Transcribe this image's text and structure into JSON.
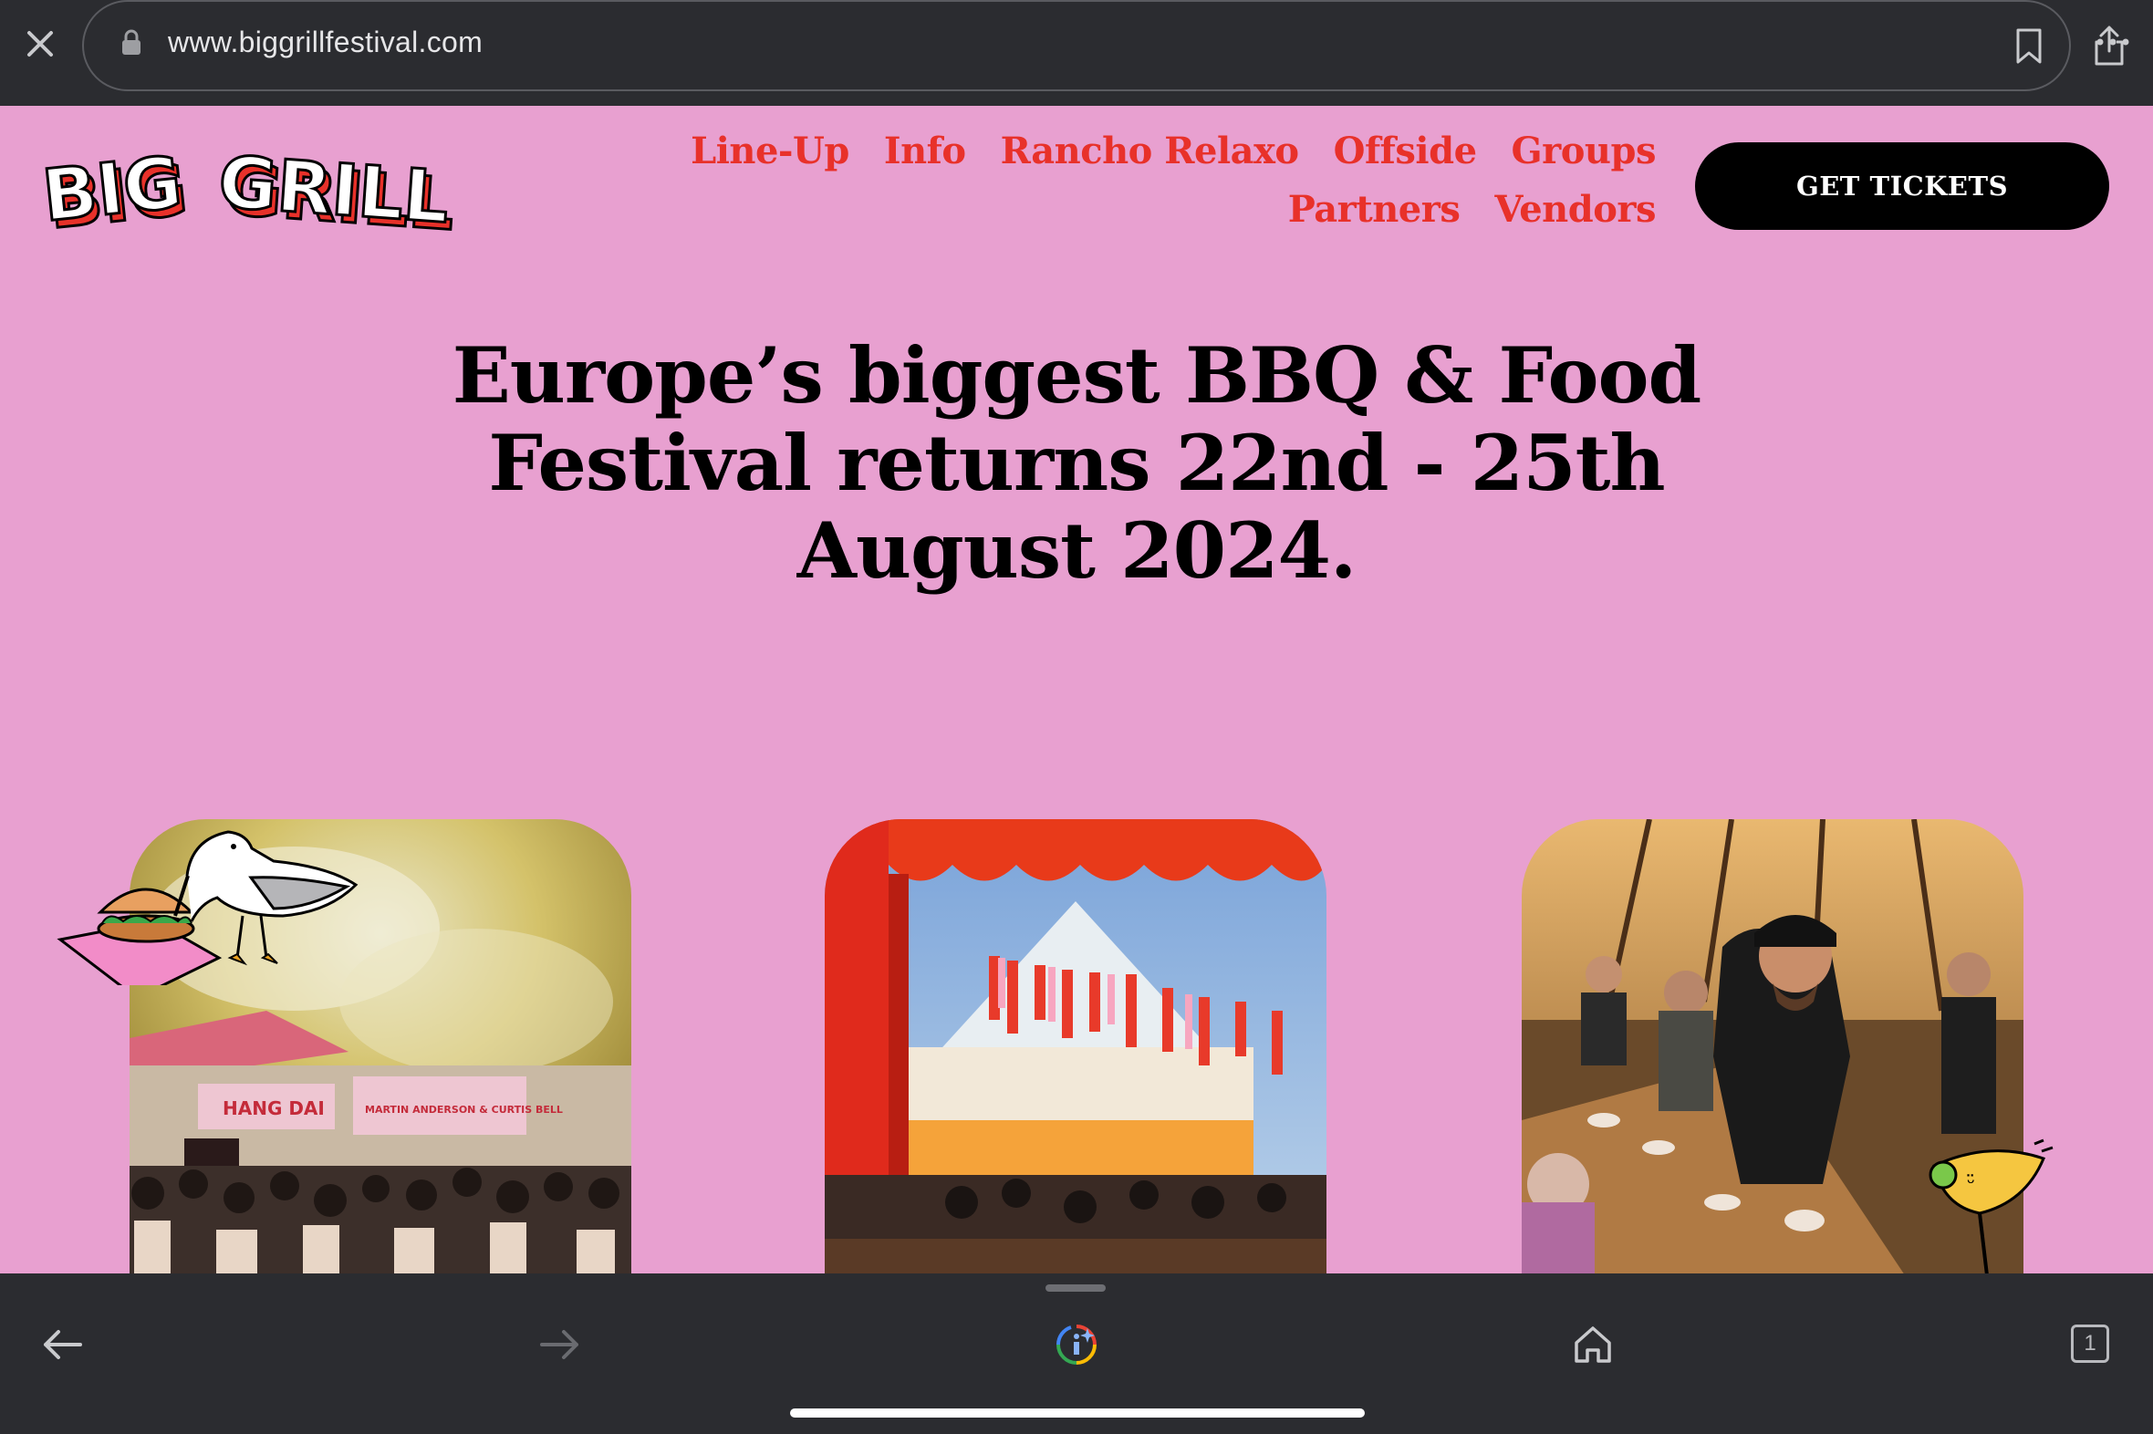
{
  "browser": {
    "url": "www.biggrillfestival.com",
    "tab_count": "1"
  },
  "site": {
    "logo_text": "BIG GRILL",
    "nav": {
      "row1": [
        "Line-Up",
        "Info",
        "Rancho Relaxo",
        "Offside",
        "Groups"
      ],
      "row2": [
        "Partners",
        "Vendors"
      ]
    },
    "cta_label": "GET TICKETS"
  },
  "hero": {
    "line1": "Europe’s biggest BBQ & Food",
    "line2": "Festival returns 22nd - 25th",
    "line3": "August 2024."
  },
  "photos": {
    "card1_sign_left": "HANG DAI",
    "card1_sign_right": "MARTIN ANDERSON & CURTIS BELL"
  },
  "colors": {
    "background": "#e8a0d0",
    "nav_red": "#e8312a",
    "button": "#000000",
    "browser_chrome": "#2b2c30"
  }
}
